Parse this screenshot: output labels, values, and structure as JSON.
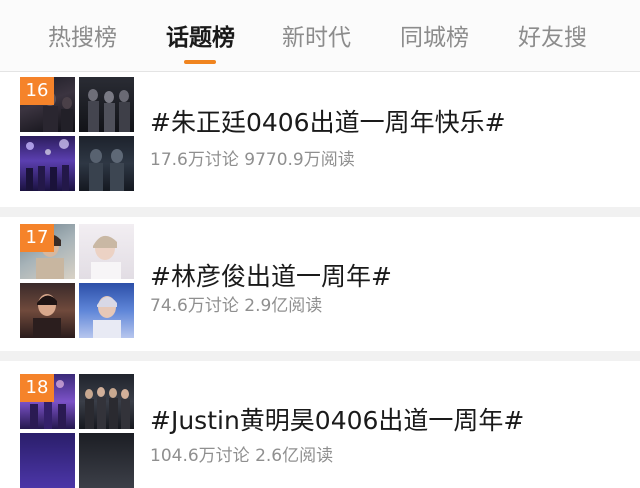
{
  "tabs": [
    {
      "label": "热搜榜",
      "active": false
    },
    {
      "label": "话题榜",
      "active": true
    },
    {
      "label": "新时代",
      "active": false
    },
    {
      "label": "同城榜",
      "active": false
    },
    {
      "label": "好友搜",
      "active": false
    }
  ],
  "accent_color": "#f0841f",
  "badge_color": "#f5832a",
  "topics": [
    {
      "rank": "16",
      "title": "#朱正廷0406出道一周年快乐#",
      "meta": "17.6万讨论 9770.9万阅读"
    },
    {
      "rank": "17",
      "title": "#林彦俊出道一周年#",
      "meta": "74.6万讨论 2.9亿阅读"
    },
    {
      "rank": "18",
      "title": "#Justin黄明昊0406出道一周年#",
      "meta": "104.6万讨论 2.6亿阅读"
    }
  ]
}
